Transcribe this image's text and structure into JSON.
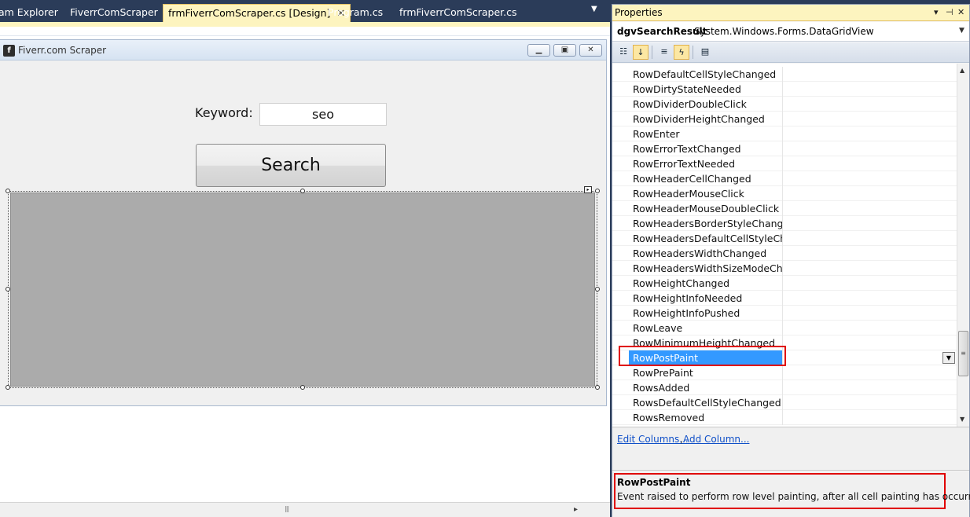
{
  "tabs": [
    {
      "label": "am Explorer"
    },
    {
      "label": "FiverrComScraper"
    },
    {
      "label": "frmFiverrComScraper.cs [Design]"
    },
    {
      "label": "Program.cs"
    },
    {
      "label": "frmFiverrComScraper.cs"
    }
  ],
  "form": {
    "title": "Fiverr.com Scraper",
    "keyword_label": "Keyword:",
    "keyword_value": "seo",
    "search_label": "Search"
  },
  "properties": {
    "title": "Properties",
    "object_name": "dgvSearchResult",
    "object_type": "System.Windows.Forms.DataGridView",
    "events": [
      "RowDefaultCellStyleChanged",
      "RowDirtyStateNeeded",
      "RowDividerDoubleClick",
      "RowDividerHeightChanged",
      "RowEnter",
      "RowErrorTextChanged",
      "RowErrorTextNeeded",
      "RowHeaderCellChanged",
      "RowHeaderMouseClick",
      "RowHeaderMouseDoubleClick",
      "RowHeadersBorderStyleChanged",
      "RowHeadersDefaultCellStyleChange",
      "RowHeadersWidthChanged",
      "RowHeadersWidthSizeModeChange",
      "RowHeightChanged",
      "RowHeightInfoNeeded",
      "RowHeightInfoPushed",
      "RowLeave",
      "RowMinimumHeightChanged",
      "RowPostPaint",
      "RowPrePaint",
      "RowsAdded",
      "RowsDefaultCellStyleChanged",
      "RowsRemoved"
    ],
    "selected_index": 19,
    "commands": {
      "edit_columns": "Edit Columns...",
      "separator": ",",
      "add_column": "Add Column..."
    },
    "description": {
      "title": "RowPostPaint",
      "text": "Event raised to perform row level painting, after all cell painting has occurred."
    }
  },
  "colors": {
    "selection": "#3399ff",
    "highlight_box": "#e00000",
    "tab_active": "#fdf4bf",
    "chrome": "#2b3c59"
  },
  "icons": [
    "form-icon",
    "minimize-icon",
    "maximize-icon",
    "close-icon",
    "pin-icon",
    "dropdown-icon",
    "categorized-icon",
    "alphabetical-icon",
    "properties-icon",
    "events-icon",
    "property-pages-icon"
  ]
}
